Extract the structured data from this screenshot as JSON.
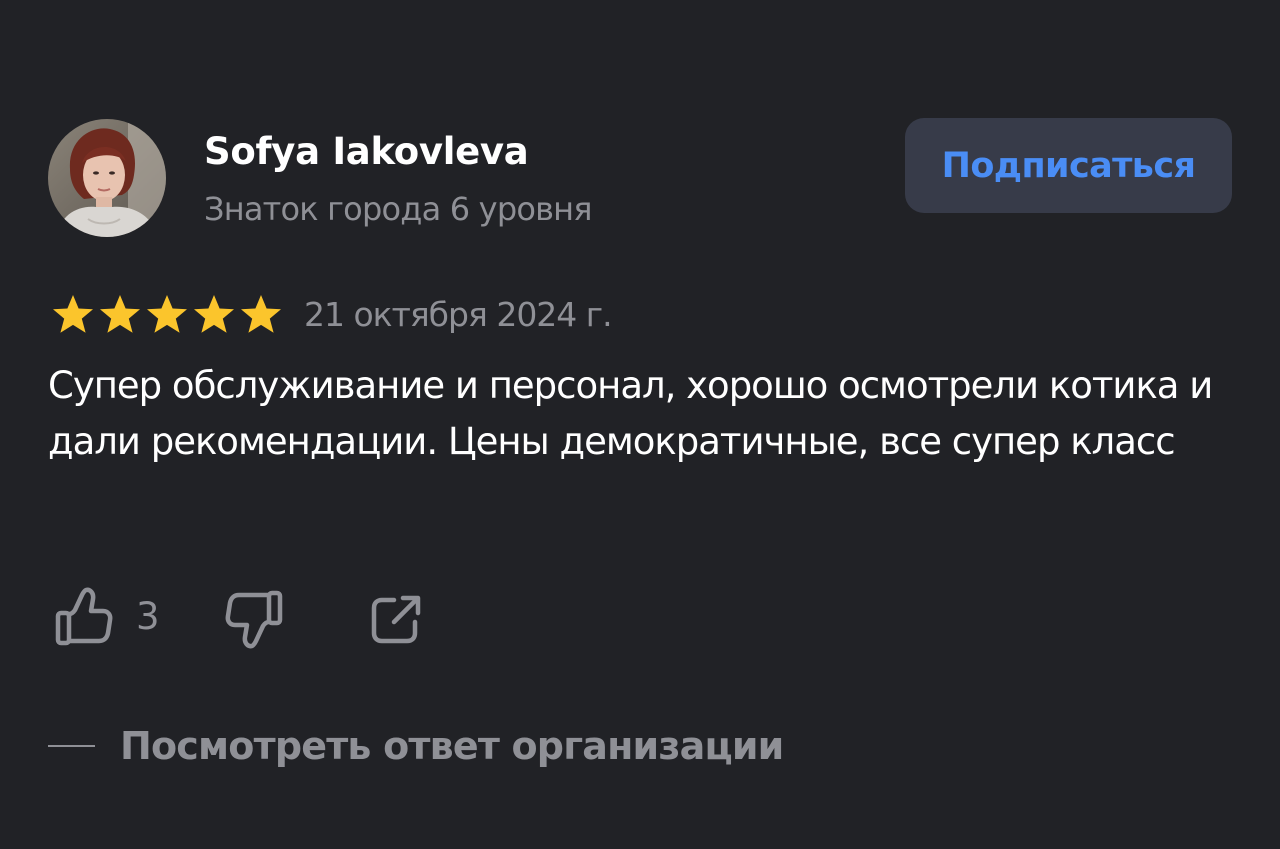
{
  "author": {
    "name": "Sofya Iakovleva",
    "level": "Знаток города 6 уровня",
    "avatar_icon": "avatar-photo"
  },
  "subscribe": {
    "label": "Подписаться",
    "color": "#4a8df5"
  },
  "review": {
    "rating": 5,
    "rating_max": 5,
    "date": "21 октября 2024 г.",
    "text": "Супер обслуживание и персонал, хорошо осмотрели котика и дали рекомендации. Цены демократичные, все супер класс"
  },
  "actions": {
    "like_icon": "thumbs-up-icon",
    "like_count": "3",
    "dislike_icon": "thumbs-down-icon",
    "share_icon": "share-icon"
  },
  "org_answer": {
    "label": "Посмотреть ответ организации"
  },
  "colors": {
    "background": "#212226",
    "star": "#fbc52c",
    "muted_text": "#8f9096",
    "button_bg": "#373b49"
  }
}
